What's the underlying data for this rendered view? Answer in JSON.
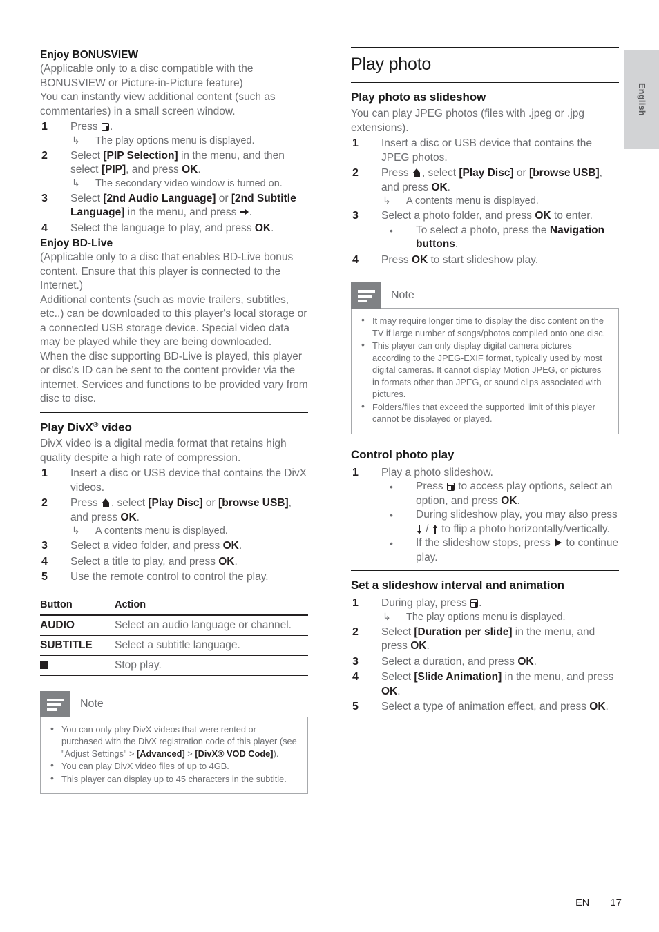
{
  "sidebar": {
    "language_tab": "English"
  },
  "footer": {
    "lang_code": "EN",
    "page_number": "17"
  },
  "left_column": {
    "bonusview": {
      "heading": "Enjoy BONUSVIEW",
      "intro_1": "(Applicable only to a disc compatible with the BONUSVIEW or Picture-in-Picture feature)",
      "intro_2": "You can instantly view additional content (such as commentaries) in a small screen window.",
      "steps": [
        {
          "num": "1",
          "text_pre": "Press ",
          "icon": "options-icon",
          "text_post": ".",
          "result": "The play options menu is displayed."
        },
        {
          "num": "2",
          "p1": "Select ",
          "b1": "[PIP Selection]",
          "p2": " in the menu, and then select ",
          "b2": "[PIP]",
          "p3": ", and press ",
          "b3": "OK",
          "p4": ".",
          "result": "The secondary video window is turned on."
        },
        {
          "num": "3",
          "p1": "Select ",
          "b1": "[2nd Audio Language]",
          "p2": " or ",
          "b2": "[2nd Subtitle Language]",
          "p3": " in the menu, and press ",
          "icon": "right-arrow-icon",
          "p4": "."
        },
        {
          "num": "4",
          "p1": "Select the language to play, and press ",
          "b1": "OK",
          "p2": "."
        }
      ]
    },
    "bdlive": {
      "heading": "Enjoy BD-Live",
      "paragraphs": [
        "(Applicable only to a disc that enables BD-Live bonus content. Ensure that this player is connected to the Internet.)",
        "Additional contents (such as movie trailers, subtitles, etc.,) can be downloaded to this player's local storage or a connected USB storage device. Special video data may be played while they are being downloaded.",
        "When the disc supporting BD-Live is played, this player or disc's ID can be sent to the content provider via the internet. Services and functions to be provided vary from disc to disc."
      ]
    },
    "divx": {
      "heading": "Play DivX",
      "heading_sup": "®",
      "heading_tail": " video",
      "intro": "DivX video is a digital media format that retains high quality despite a high rate of compression.",
      "steps": [
        {
          "num": "1",
          "p1": "Insert a disc or USB device that contains the DivX videos."
        },
        {
          "num": "2",
          "p1": "Press ",
          "icon": "home-icon",
          "p2": ", select ",
          "b1": "[Play Disc]",
          "p3": " or ",
          "b2": "[browse USB]",
          "p4": ", and press ",
          "b3": "OK",
          "p5": ".",
          "result": "A contents menu is displayed."
        },
        {
          "num": "3",
          "p1": "Select a video folder, and press ",
          "b1": "OK",
          "p2": "."
        },
        {
          "num": "4",
          "p1": "Select a title to play, and press ",
          "b1": "OK",
          "p2": "."
        },
        {
          "num": "5",
          "p1": "Use the remote control to control the play."
        }
      ],
      "table": {
        "headers": [
          "Button",
          "Action"
        ],
        "rows": [
          {
            "key": "AUDIO",
            "key_icon": null,
            "action": "Select an audio language or channel."
          },
          {
            "key": "SUBTITLE",
            "key_icon": null,
            "action": "Select a subtitle language."
          },
          {
            "key": "",
            "key_icon": "stop-icon",
            "action": "Stop play."
          }
        ]
      },
      "note": {
        "title": "Note",
        "items": [
          {
            "p1": "You can only play DivX videos that were rented or purchased with the DivX registration code of this player (see \"Adjust Settings\" > ",
            "b1": "[Advanced]",
            "p2": " > ",
            "b2": "[DivX® VOD Code]",
            "p3": ")."
          },
          {
            "p1": "You can play DivX video files of up to 4GB."
          },
          {
            "p1": "This player can display up to 45 characters in the subtitle."
          }
        ]
      }
    }
  },
  "right_column": {
    "play_photo": {
      "heading": "Play photo",
      "slideshow": {
        "heading": "Play photo as slideshow",
        "intro": "You can play JPEG photos (files with .jpeg or .jpg extensions).",
        "steps": [
          {
            "num": "1",
            "p1": "Insert a disc or USB device that contains the JPEG photos."
          },
          {
            "num": "2",
            "p1": "Press ",
            "icon": "home-icon",
            "p2": ", select ",
            "b1": "[Play Disc]",
            "p3": " or ",
            "b2": "[browse USB]",
            "p4": ", and press ",
            "b3": "OK",
            "p5": ".",
            "result": "A contents menu is displayed."
          },
          {
            "num": "3",
            "p1": "Select a photo folder, and press ",
            "b1": "OK",
            "p2": " to enter.",
            "bullet_p1": "To select a photo, press the ",
            "bullet_b1": "Navigation buttons",
            "bullet_p2": "."
          },
          {
            "num": "4",
            "p1": "Press ",
            "b1": "OK",
            "p2": " to start slideshow play."
          }
        ],
        "note": {
          "title": "Note",
          "items": [
            {
              "p1": "It may require longer time to display the disc content on the TV if large number of songs/photos compiled onto one disc."
            },
            {
              "p1": "This player can only display digital camera pictures according to the JPEG-EXIF format, typically used by most digital cameras. It cannot display Motion JPEG, or pictures in formats other than JPEG, or sound clips associated with pictures."
            },
            {
              "p1": "Folders/files that exceed the supported limit of this player cannot be displayed or played."
            }
          ]
        }
      },
      "control": {
        "heading": "Control photo play",
        "step_num": "1",
        "step_text": "Play a photo slideshow.",
        "bullets": [
          {
            "p1": "Press ",
            "icon": "options-icon",
            "p2": " to access play options, select an option, and press ",
            "b1": "OK",
            "p3": "."
          },
          {
            "p1": "During slideshow play, you may also press ",
            "icon_a": "flip-up-icon",
            "sep": " / ",
            "icon_b": "flip-down-icon",
            "p2": " to flip a photo horizontally/vertically."
          },
          {
            "p1": "If the slideshow stops, press ",
            "icon": "play-icon",
            "p2": " to continue play."
          }
        ]
      },
      "interval": {
        "heading": "Set a slideshow interval and animation",
        "steps": [
          {
            "num": "1",
            "p1": "During play, press ",
            "icon": "options-icon",
            "p2": ".",
            "result": "The play options menu is displayed."
          },
          {
            "num": "2",
            "p1": "Select ",
            "b1": "[Duration per slide]",
            "p2": " in the menu, and press ",
            "b2": "OK",
            "p3": "."
          },
          {
            "num": "3",
            "p1": "Select a duration, and press ",
            "b1": "OK",
            "p2": "."
          },
          {
            "num": "4",
            "p1": "Select ",
            "b1": "[Slide Animation]",
            "p2": " in the menu, and press ",
            "b2": "OK",
            "p3": "."
          },
          {
            "num": "5",
            "p1": "Select a type of animation effect, and press ",
            "b1": "OK",
            "p2": "."
          }
        ]
      }
    }
  }
}
